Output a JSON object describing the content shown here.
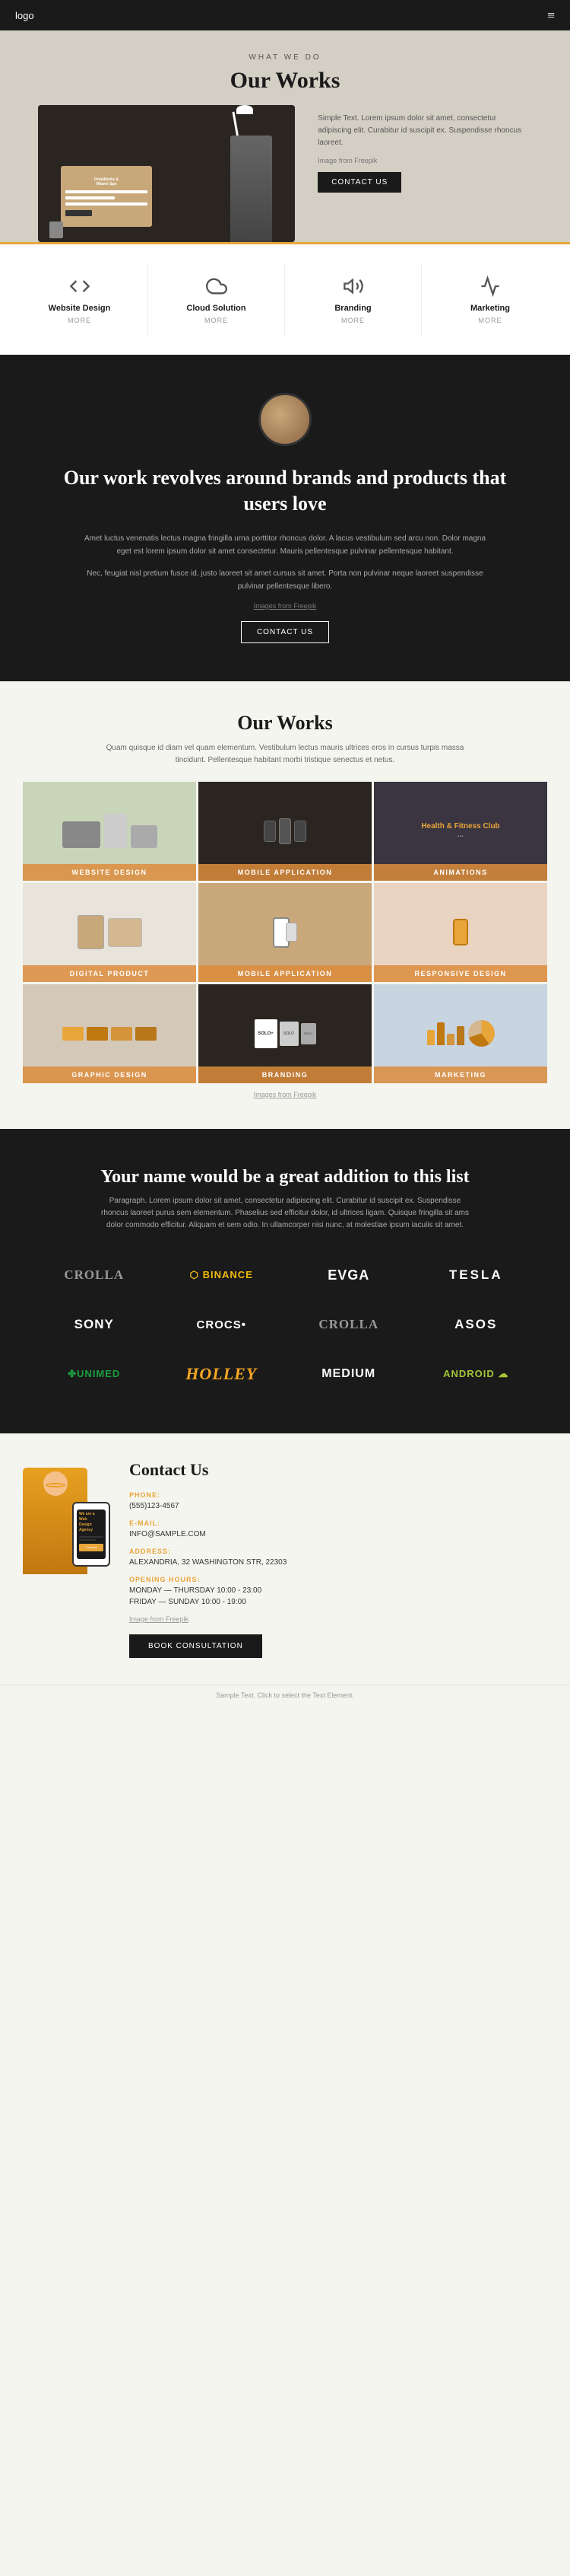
{
  "nav": {
    "logo": "logo",
    "menu_icon": "≡"
  },
  "hero": {
    "label": "WHAT WE DO",
    "title": "Our Works",
    "description": "Simple Text. Lorem ipsum dolor sit amet, consectetur adipiscing elit. Curabitur id suscipit ex. Suspendisse rhoncus laoreet.",
    "image_credit": "Image from Freepik",
    "contact_btn": "CONTACT US"
  },
  "services": [
    {
      "name": "Website Design",
      "more": "MORE",
      "icon": "code"
    },
    {
      "name": "Cloud Solution",
      "more": "MORE",
      "icon": "cloud"
    },
    {
      "name": "Branding",
      "more": "MORE",
      "icon": "megaphone"
    },
    {
      "name": "Marketing",
      "more": "MORE",
      "icon": "graph"
    }
  ],
  "about": {
    "title": "Our work revolves around brands and products that users love",
    "para1": "Amet luctus venenatis lectus magna fringilla urna porttitor rhoncus dolor. A lacus vestibulum sed arcu non. Dolor magna eget est lorem ipsum dolor sit amet consectetur. Mauris pellentesque pulvinar pellentesque habitant.",
    "para2": "Nec, feugiat nisl pretium fusce id, justo laoreet sit amet cursus sit amet. Porta non pulvinar neque laoreet suspendisse pulvinar pellentesque libero.",
    "image_credit": "Images from Freepik",
    "contact_btn": "CONTACT US"
  },
  "portfolio": {
    "title": "Our Works",
    "description": "Quam quisque id diam vel quam elementum. Vestibulum lectus mauris ultrices eros in cursus turpis massa tincidunt. Pellentesque habitant morbi tristique senectus et netus.",
    "items": [
      {
        "label": "WEBSITE DESIGN",
        "bg": "pi-1"
      },
      {
        "label": "MOBILE APPLICATION",
        "bg": "pi-2"
      },
      {
        "label": "ANIMATIONS",
        "bg": "pi-3"
      },
      {
        "label": "DIGITAL PRODUCT",
        "bg": "pi-4"
      },
      {
        "label": "MOBILE APPLICATION",
        "bg": "pi-5"
      },
      {
        "label": "RESPONSIVE DESIGN",
        "bg": "pi-6"
      },
      {
        "label": "GRAPHIC DESIGN",
        "bg": "pi-7"
      },
      {
        "label": "BRANDING",
        "bg": "pi-8"
      },
      {
        "label": "MARKETING",
        "bg": "pi-9"
      }
    ],
    "credit": "Images from Freepik"
  },
  "clients": {
    "title": "Your name would be a great addition to this list",
    "description": "Paragraph. Lorem ipsum dolor sit amet, consectetur adipiscing elit. Curabitur id suscipit ex. Suspendisse rhoncus laoreet purus sem elementum. Phaselius sed efficitur dolor, id ultrices ligam. Quisque fringilla sit ams dolor commodo efficitur. Aliquam et sem odio. In ullamcorper nisi nunc, at molestiae ipsum iaculis sit amet.",
    "logos": [
      {
        "name": "CROLLA",
        "style": "crolla"
      },
      {
        "name": "❋BINANCE",
        "style": "binance"
      },
      {
        "name": "EVGA",
        "style": "evga"
      },
      {
        "name": "TESLA",
        "style": "tesla"
      },
      {
        "name": "SONY",
        "style": "sony"
      },
      {
        "name": "crocs•",
        "style": "crocs"
      },
      {
        "name": "CROLLA",
        "style": "crolla2"
      },
      {
        "name": "asos",
        "style": "asos"
      },
      {
        "name": "✤unimed",
        "style": "unimed"
      },
      {
        "name": "Holley",
        "style": "holley"
      },
      {
        "name": "Medium",
        "style": "medium"
      },
      {
        "name": "android ☁",
        "style": "android"
      }
    ]
  },
  "contact": {
    "title": "Contact Us",
    "phone_label": "PHONE:",
    "phone_value": "(555)123-4567",
    "email_label": "E-MAIL:",
    "email_value": "INFO@SAMPLE.COM",
    "address_label": "ADDRESS:",
    "address_value": "ALEXANDRIA, 32 WASHINGTON STR, 22303",
    "hours_label": "OPENING HOURS:",
    "hours_value_1": "MONDAY — THURSDAY 10:00 - 23:00",
    "hours_value_2": "FRIDAY — SUNDAY 10:00 - 19:00",
    "image_credit": "Image from Freepik",
    "book_btn": "BOOK CONSULTATION",
    "phone_screen_text": "We are a Web Design Agency"
  },
  "footer": {
    "note": "Sample Text. Click to select the Text Element."
  }
}
